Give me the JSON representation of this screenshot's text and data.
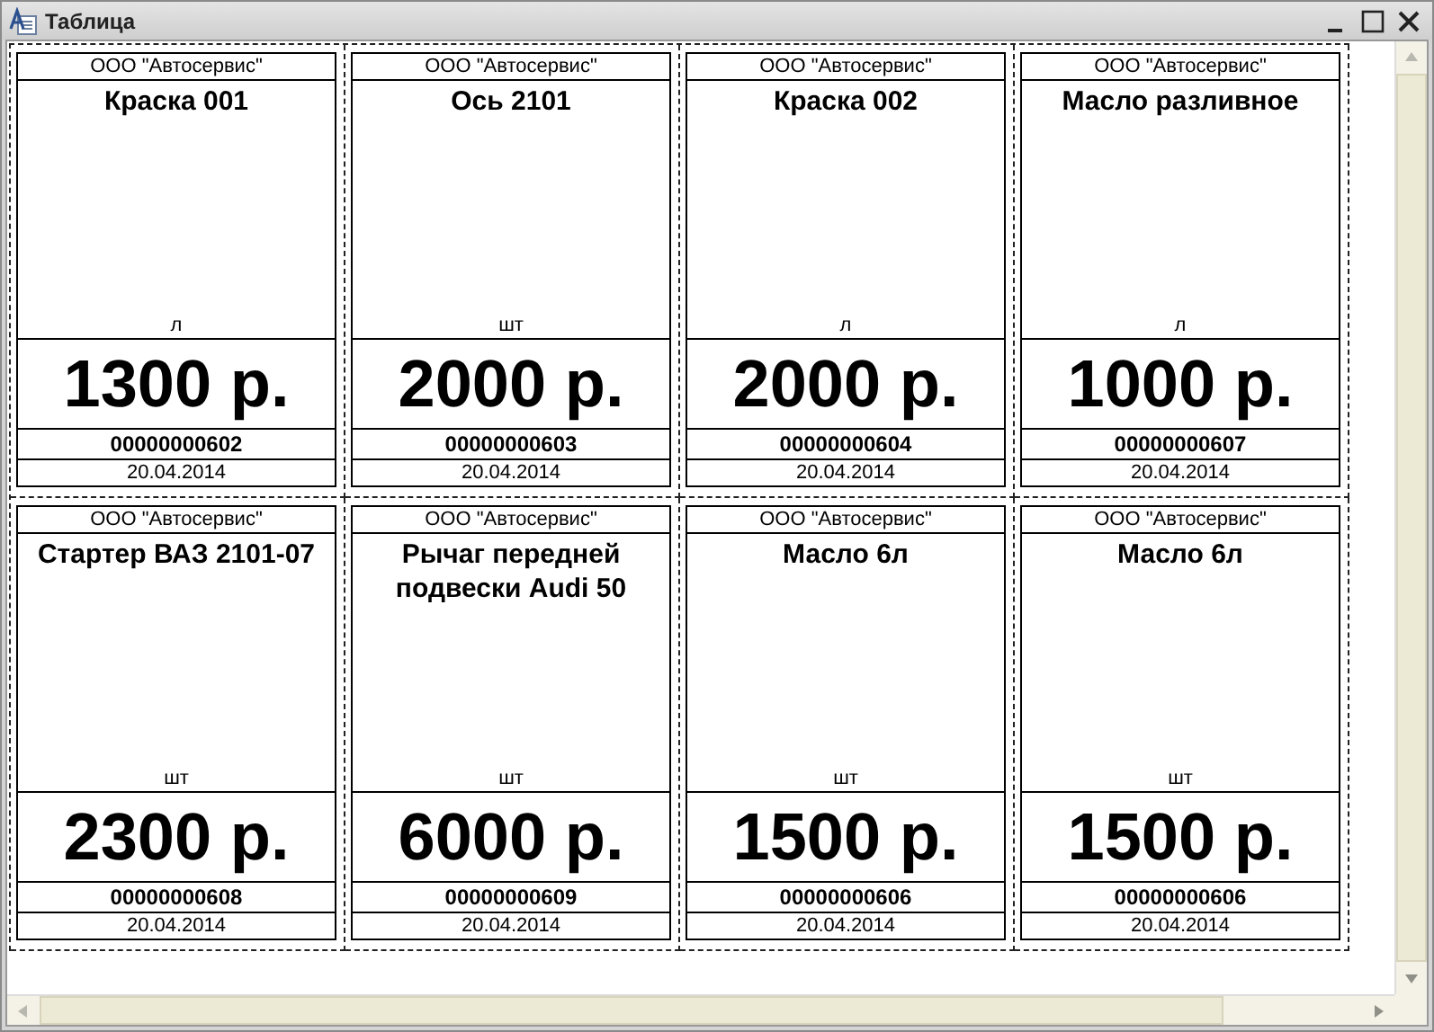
{
  "window": {
    "title": "Таблица"
  },
  "labels": [
    {
      "org": "ООО \"Автосервис\"",
      "name": "Краска 001",
      "unit": "л",
      "price": "1300 р.",
      "code": "00000000602",
      "date": "20.04.2014"
    },
    {
      "org": "ООО \"Автосервис\"",
      "name": "Ось 2101",
      "unit": "шт",
      "price": "2000 р.",
      "code": "00000000603",
      "date": "20.04.2014"
    },
    {
      "org": "ООО \"Автосервис\"",
      "name": "Краска 002",
      "unit": "л",
      "price": "2000 р.",
      "code": "00000000604",
      "date": "20.04.2014"
    },
    {
      "org": "ООО \"Автосервис\"",
      "name": "Масло разливное",
      "unit": "л",
      "price": "1000 р.",
      "code": "00000000607",
      "date": "20.04.2014"
    },
    {
      "org": "ООО \"Автосервис\"",
      "name": "Стартер ВАЗ 2101-07",
      "unit": "шт",
      "price": "2300 р.",
      "code": "00000000608",
      "date": "20.04.2014"
    },
    {
      "org": "ООО \"Автосервис\"",
      "name": "Рычаг передней подвески Audi 50",
      "unit": "шт",
      "price": "6000 р.",
      "code": "00000000609",
      "date": "20.04.2014"
    },
    {
      "org": "ООО \"Автосервис\"",
      "name": "Масло 6л",
      "unit": "шт",
      "price": "1500 р.",
      "code": "00000000606",
      "date": "20.04.2014"
    },
    {
      "org": "ООО \"Автосервис\"",
      "name": "Масло 6л",
      "unit": "шт",
      "price": "1500 р.",
      "code": "00000000606",
      "date": "20.04.2014"
    }
  ]
}
